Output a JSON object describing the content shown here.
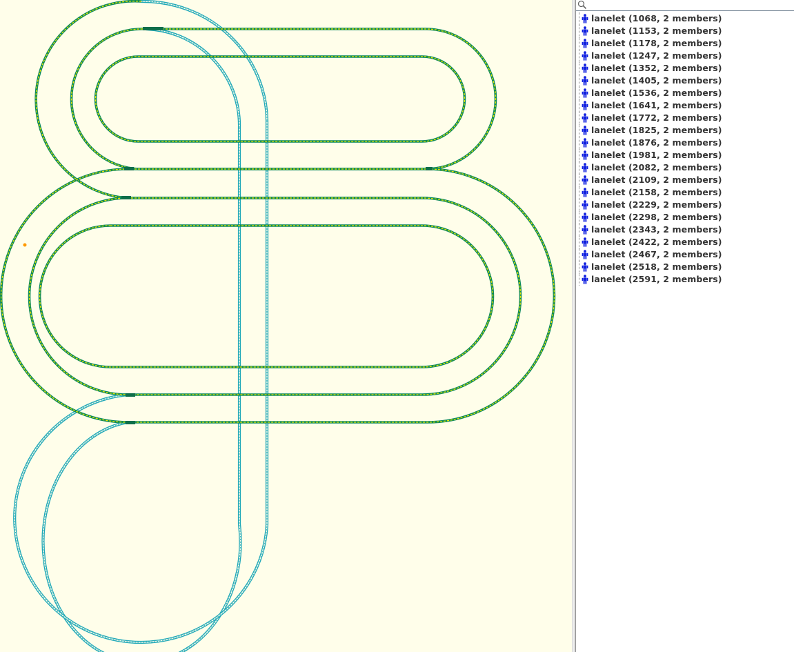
{
  "search": {
    "placeholder": "",
    "value": ""
  },
  "relations": [
    {
      "label": "lanelet (1068, 2 members)"
    },
    {
      "label": "lanelet (1153, 2 members)"
    },
    {
      "label": "lanelet (1178, 2 members)"
    },
    {
      "label": "lanelet (1247, 2 members)"
    },
    {
      "label": "lanelet (1352, 2 members)"
    },
    {
      "label": "lanelet (1405, 2 members)"
    },
    {
      "label": "lanelet (1536, 2 members)"
    },
    {
      "label": "lanelet (1641, 2 members)"
    },
    {
      "label": "lanelet (1772, 2 members)"
    },
    {
      "label": "lanelet (1825, 2 members)"
    },
    {
      "label": "lanelet (1876, 2 members)"
    },
    {
      "label": "lanelet (1981, 2 members)"
    },
    {
      "label": "lanelet (2082, 2 members)"
    },
    {
      "label": "lanelet (2109, 2 members)"
    },
    {
      "label": "lanelet (2158, 2 members)"
    },
    {
      "label": "lanelet (2229, 2 members)"
    },
    {
      "label": "lanelet (2298, 2 members)"
    },
    {
      "label": "lanelet (2343, 2 members)"
    },
    {
      "label": "lanelet (2422, 2 members)"
    },
    {
      "label": "lanelet (2467, 2 members)"
    },
    {
      "label": "lanelet (2518, 2 members)"
    },
    {
      "label": "lanelet (2591, 2 members)"
    }
  ],
  "icons": {
    "search": "search-icon",
    "relation": "relation-icon"
  },
  "colors": {
    "map_background": "#fffeea",
    "track_green": "#0e8a5a",
    "track_yellow": "#e8e800",
    "track_cyan": "#1fa8b8",
    "relation_icon_blue": "#1020e0"
  }
}
